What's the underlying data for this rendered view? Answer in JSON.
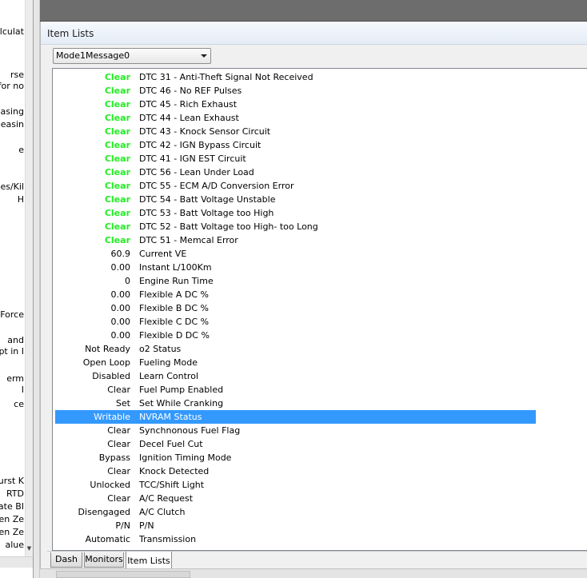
{
  "left_panel": {
    "lines": [
      {
        "text": "alculat",
        "top": 0
      },
      {
        "text": "rse",
        "top": 0
      },
      {
        "text": "for no",
        "top": 0
      },
      {
        "text": "easing",
        "top": 0
      },
      {
        "text": "easin",
        "top": 0
      },
      {
        "text": "e",
        "top": 0
      },
      {
        "text": "ses/Kil",
        "top": 0
      },
      {
        "text": "H",
        "top": 0
      },
      {
        "text": "Force",
        "top": 0
      },
      {
        "text": "and",
        "top": 0
      },
      {
        "text": "pt in I",
        "top": 0
      },
      {
        "text": "erm",
        "top": 0
      },
      {
        "text": "I",
        "top": 0
      },
      {
        "text": "ce",
        "top": 0
      },
      {
        "text": "urst K",
        "top": 0
      },
      {
        "text": "RTD",
        "top": 0
      },
      {
        "text": "ate BI",
        "top": 0
      },
      {
        "text": "en Ze",
        "top": 0
      },
      {
        "text": "en Ze",
        "top": 0
      },
      {
        "text": "alue",
        "top": 0
      }
    ],
    "scroll_down_glyph": "▼"
  },
  "panel": {
    "title": "Item Lists",
    "selected_message": "Mode1Message0"
  },
  "items": [
    {
      "value": "Clear",
      "name": "DTC 31 - Anti-Theft Signal Not Received",
      "status_green": true
    },
    {
      "value": "Clear",
      "name": "DTC 46 - No REF Pulses",
      "status_green": true
    },
    {
      "value": "Clear",
      "name": "DTC 45 - Rich Exhaust",
      "status_green": true
    },
    {
      "value": "Clear",
      "name": "DTC 44 - Lean Exhaust",
      "status_green": true
    },
    {
      "value": "Clear",
      "name": "DTC 43 - Knock Sensor Circuit",
      "status_green": true
    },
    {
      "value": "Clear",
      "name": "DTC 42 - IGN Bypass Circuit",
      "status_green": true
    },
    {
      "value": "Clear",
      "name": "DTC 41 - IGN EST Circuit",
      "status_green": true
    },
    {
      "value": "Clear",
      "name": "DTC 56 - Lean Under Load",
      "status_green": true
    },
    {
      "value": "Clear",
      "name": "DTC 55 - ECM A/D Conversion Error",
      "status_green": true
    },
    {
      "value": "Clear",
      "name": "DTC 54 - Batt Voltage Unstable",
      "status_green": true
    },
    {
      "value": "Clear",
      "name": "DTC 53 - Batt Voltage too High",
      "status_green": true
    },
    {
      "value": "Clear",
      "name": "DTC 52 - Batt Voltage too High- too Long",
      "status_green": true
    },
    {
      "value": "Clear",
      "name": "DTC 51 - Memcal Error",
      "status_green": true
    },
    {
      "value": "60.9",
      "name": "Current VE"
    },
    {
      "value": "0.00",
      "name": "Instant L/100Km"
    },
    {
      "value": "0",
      "name": "Engine Run Time"
    },
    {
      "value": "0.00",
      "name": "Flexible A DC %"
    },
    {
      "value": "0.00",
      "name": "Flexible B DC %"
    },
    {
      "value": "0.00",
      "name": "Flexible C DC %"
    },
    {
      "value": "0.00",
      "name": "Flexible D DC %"
    },
    {
      "value": "Not Ready",
      "name": "o2 Status"
    },
    {
      "value": "Open Loop",
      "name": "Fueling Mode"
    },
    {
      "value": "Disabled",
      "name": "Learn Control"
    },
    {
      "value": "Clear",
      "name": "Fuel Pump Enabled"
    },
    {
      "value": "Set",
      "name": "Set While Cranking"
    },
    {
      "value": "Writable",
      "name": "NVRAM Status",
      "selected": true
    },
    {
      "value": "Clear",
      "name": "Synchnonous Fuel Flag"
    },
    {
      "value": "Clear",
      "name": "Decel Fuel Cut"
    },
    {
      "value": "Bypass",
      "name": "Ignition Timing Mode"
    },
    {
      "value": "Clear",
      "name": "Knock Detected"
    },
    {
      "value": "Unlocked",
      "name": "TCC/Shift Light"
    },
    {
      "value": "Clear",
      "name": "A/C Request"
    },
    {
      "value": "Disengaged",
      "name": "A/C Clutch"
    },
    {
      "value": "P/N",
      "name": "P/N"
    },
    {
      "value": "Automatic",
      "name": "Transmission"
    }
  ],
  "tabs": [
    {
      "label": "Dash"
    },
    {
      "label": "Monitors"
    },
    {
      "label": "Item Lists",
      "active": true
    }
  ],
  "colors": {
    "clear_green": "#22ee22",
    "selection_blue": "#3399ff"
  }
}
